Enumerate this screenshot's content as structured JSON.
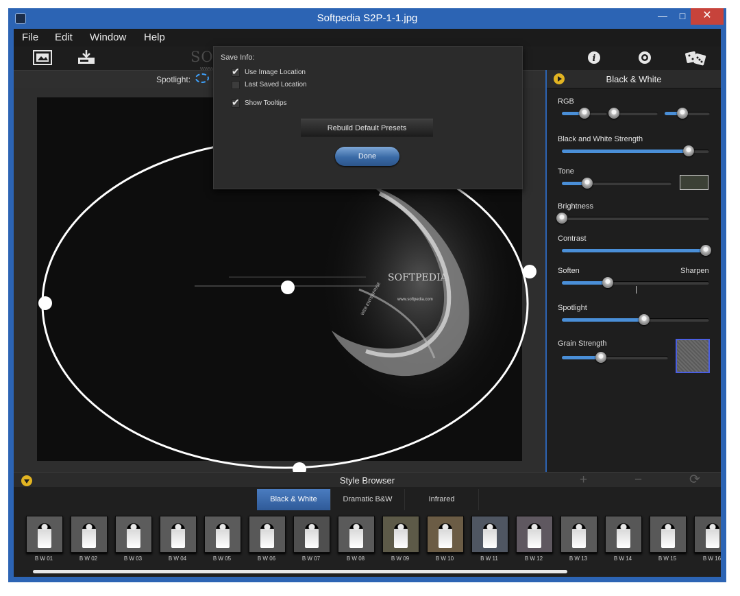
{
  "window": {
    "title": "Softpedia S2P-1-1.jpg",
    "minimize_glyph": "—",
    "maximize_glyph": "□",
    "close_glyph": "✕"
  },
  "menu": [
    "File",
    "Edit",
    "Window",
    "Help"
  ],
  "toolbar": {
    "left_icons": [
      "open-image-icon",
      "save-export-icon"
    ],
    "right_icons": [
      "info-icon",
      "settings-gear-icon",
      "random-dice-icon"
    ]
  },
  "watermark": {
    "logo": "SOFTPEDIA",
    "url": "www.softpedia.com"
  },
  "spotlight_bar": {
    "label": "Spotlight:"
  },
  "canvas": {
    "photo_text": {
      "logo": "SOFTPEDIA",
      "url": "www.softpedia.com",
      "vertical": "WEB ENTERPRISE"
    }
  },
  "dialog": {
    "section": "Save Info:",
    "options": [
      {
        "label": "Use Image Location",
        "checked": true
      },
      {
        "label": "Last Saved Location",
        "checked": false
      },
      {
        "label": "Show Tooltips",
        "checked": true
      }
    ],
    "rebuild_label": "Rebuild Default Presets",
    "done_label": "Done"
  },
  "panel": {
    "title": "Black & White",
    "controls": {
      "rgb": {
        "label": "RGB",
        "values": [
          0.5,
          0.0,
          0.4
        ]
      },
      "bw_strength": {
        "label": "Black and White Strength",
        "value": 0.86
      },
      "tone": {
        "label": "Tone",
        "value": 0.23,
        "swatch_color": "#3c4136"
      },
      "brightness": {
        "label": "Brightness",
        "value": 0.0
      },
      "contrast": {
        "label": "Contrast",
        "value": 1.0
      },
      "soften_sharpen": {
        "label_left": "Soften",
        "label_right": "Sharpen",
        "value": 0.31
      },
      "spotlight": {
        "label": "Spotlight",
        "value": 0.56
      },
      "grain": {
        "label": "Grain Strength",
        "value": 0.37
      }
    }
  },
  "style_browser": {
    "title": "Style Browser",
    "tools": [
      "+",
      "−",
      "⟳"
    ],
    "tabs": [
      "Black & White",
      "Dramatic B&W",
      "Infrared"
    ],
    "active_tab": 0,
    "presets": [
      "B W 01",
      "B W 02",
      "B W 03",
      "B W 04",
      "B W 05",
      "B W 06",
      "B W 07",
      "B W 08",
      "B W 09",
      "B W 10",
      "B W 11",
      "B W 12",
      "B W 13",
      "B W 14",
      "B W 15",
      "B W 16"
    ],
    "preset_tints": [
      "#5a5a5a",
      "#575757",
      "#5c5c5c",
      "#5a5a5a",
      "#5b5b5b",
      "#585858",
      "#4f4f4f",
      "#5a5a5a",
      "#5d5a48",
      "#6b5c45",
      "#4f5662",
      "#5f5860",
      "#5a5a5a",
      "#575757",
      "#585858",
      "#555555"
    ]
  },
  "colors": {
    "titlebar": "#2c64b4",
    "accent_blue": "#4a8fd8",
    "accent_yellow": "#e2b422",
    "close_red": "#c7433b"
  }
}
